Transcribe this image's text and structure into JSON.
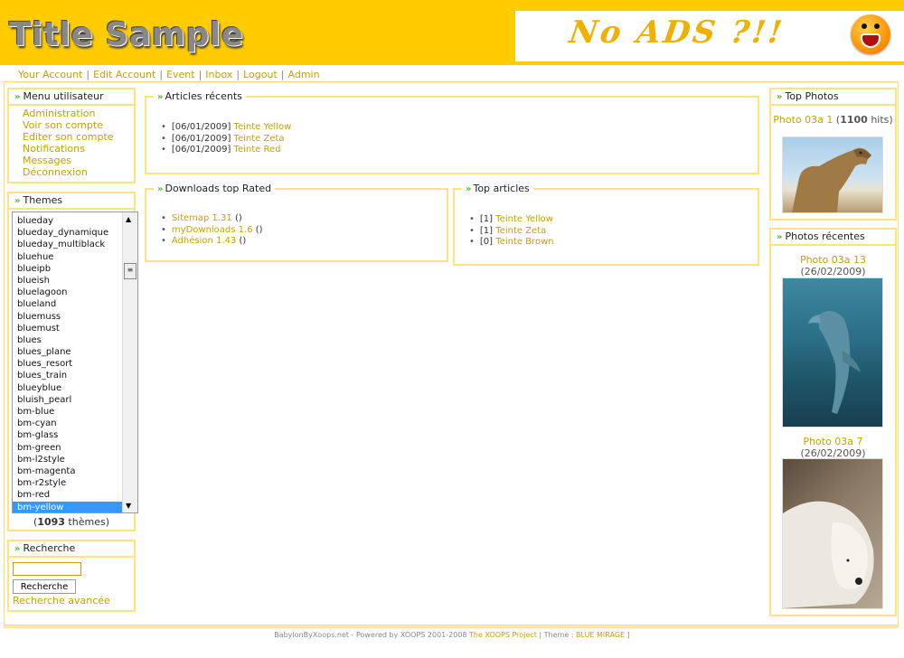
{
  "header": {
    "site_title": "Title Sample",
    "ad_text": "No ADS ?!!",
    "brand_color": "#ffcc00"
  },
  "topnav": {
    "items": [
      "Your Account",
      "Edit Account",
      "Event",
      "Inbox",
      "Logout",
      "Admin"
    ]
  },
  "user_menu": {
    "title": "Menu utilisateur",
    "items": [
      "Administration",
      "Voir son compte",
      "Editer son compte",
      "Notifications",
      "Messages",
      "Déconnexion"
    ]
  },
  "themes": {
    "title": "Themes",
    "options": [
      "blueday",
      "blueday_dynamique",
      "blueday_multiblack",
      "bluehue",
      "blueipb",
      "blueish",
      "bluelagoon",
      "blueland",
      "bluemuss",
      "bluemust",
      "blues",
      "blues_plane",
      "blues_resort",
      "blues_train",
      "blueyblue",
      "bluish_pearl",
      "bm-blue",
      "bm-cyan",
      "bm-glass",
      "bm-green",
      "bm-l2style",
      "bm-magenta",
      "bm-r2style",
      "bm-red",
      "bm-yellow"
    ],
    "selected": "bm-yellow",
    "count": "1093",
    "count_suffix": "thèmes"
  },
  "search": {
    "title": "Recherche",
    "input_value": "",
    "button_label": "Recherche",
    "advanced_label": "Recherche avancée"
  },
  "recent_articles": {
    "title": "Articles récents",
    "items": [
      {
        "date": "[06/01/2009]",
        "title": "Teinte Yellow"
      },
      {
        "date": "[06/01/2009]",
        "title": "Teinte Zeta"
      },
      {
        "date": "[06/01/2009]",
        "title": "Teinte Red"
      }
    ]
  },
  "downloads_top": {
    "title": "Downloads top Rated",
    "items": [
      {
        "name": "Sitemap 1.31",
        "extra": "()"
      },
      {
        "name": "myDownloads 1.6",
        "extra": "()"
      },
      {
        "name": "Adhésion 1.43",
        "extra": "()"
      }
    ]
  },
  "top_articles": {
    "title": "Top articles",
    "items": [
      {
        "count": "[1]",
        "title": "Teinte Yellow"
      },
      {
        "count": "[1]",
        "title": "Teinte Zeta"
      },
      {
        "count": "[0]",
        "title": "Teinte Brown"
      }
    ]
  },
  "top_photos": {
    "title": "Top Photos",
    "photo": {
      "name": "Photo 03a 1",
      "hits_prefix": "(",
      "hits": "1100",
      "hits_suffix": "hits)"
    }
  },
  "recent_photos": {
    "title": "Photos récentes",
    "photos": [
      {
        "name": "Photo 03a 13",
        "date": "(26/02/2009)"
      },
      {
        "name": "Photo 03a 7",
        "date": "(26/02/2009)"
      }
    ]
  },
  "footer": {
    "text": "BabylonByXoops.net - Powered by XOOPS 2001-2008",
    "link": "The XOOPS Project",
    "theme_prefix": "| Theme :",
    "theme_name": "BLUE MIRAGE",
    "theme_suffix": "]"
  }
}
